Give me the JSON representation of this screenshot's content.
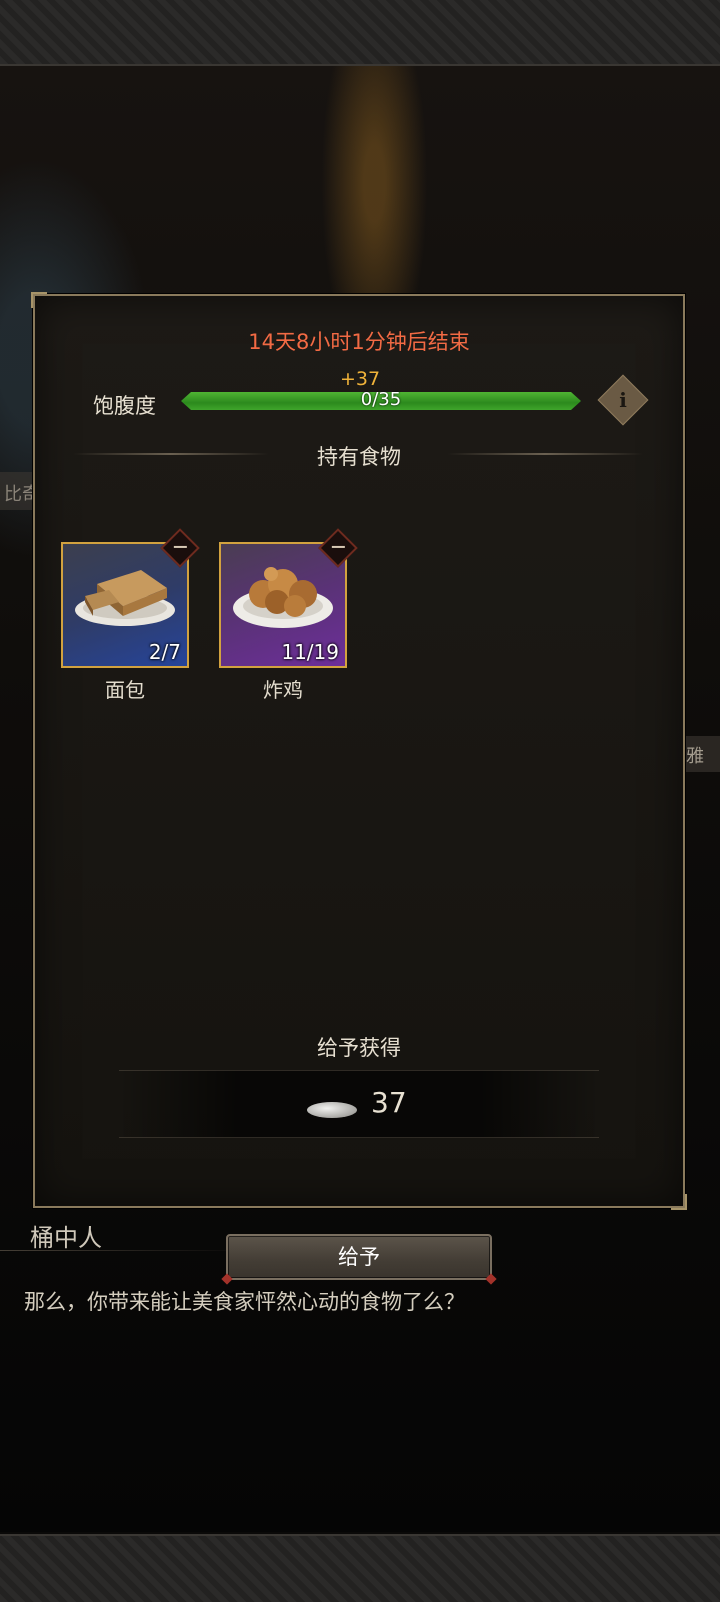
{
  "background": {
    "left_label": "比奇",
    "right_label": "雅"
  },
  "panel": {
    "timer": "14天8小时1分钟后结束",
    "hunger": {
      "label": "饱腹度",
      "gain": "+37",
      "progress_text": "0/35",
      "current": 0,
      "max": 35,
      "info_icon": "info-icon"
    },
    "owned_title": "持有食物",
    "items": [
      {
        "name": "面包",
        "count": "2/7",
        "rarity_color": "#26449a",
        "icon": "bread-icon"
      },
      {
        "name": "炸鸡",
        "count": "11/19",
        "rarity_color": "#6d2e9a",
        "icon": "fried-chicken-icon"
      }
    ],
    "reward_title": "给予获得",
    "reward_amount": "37",
    "reward_icon": "silver-coin-icon"
  },
  "give_button": {
    "label": "给予"
  },
  "dialogue": {
    "speaker": "桶中人",
    "text": "那么，你带来能让美食家怦然心动的食物了么？"
  },
  "colors": {
    "timer": "#f26a44",
    "gain": "#f0b33a",
    "bar_fill": "#3fa52b",
    "card_border": "#d2a23f"
  }
}
